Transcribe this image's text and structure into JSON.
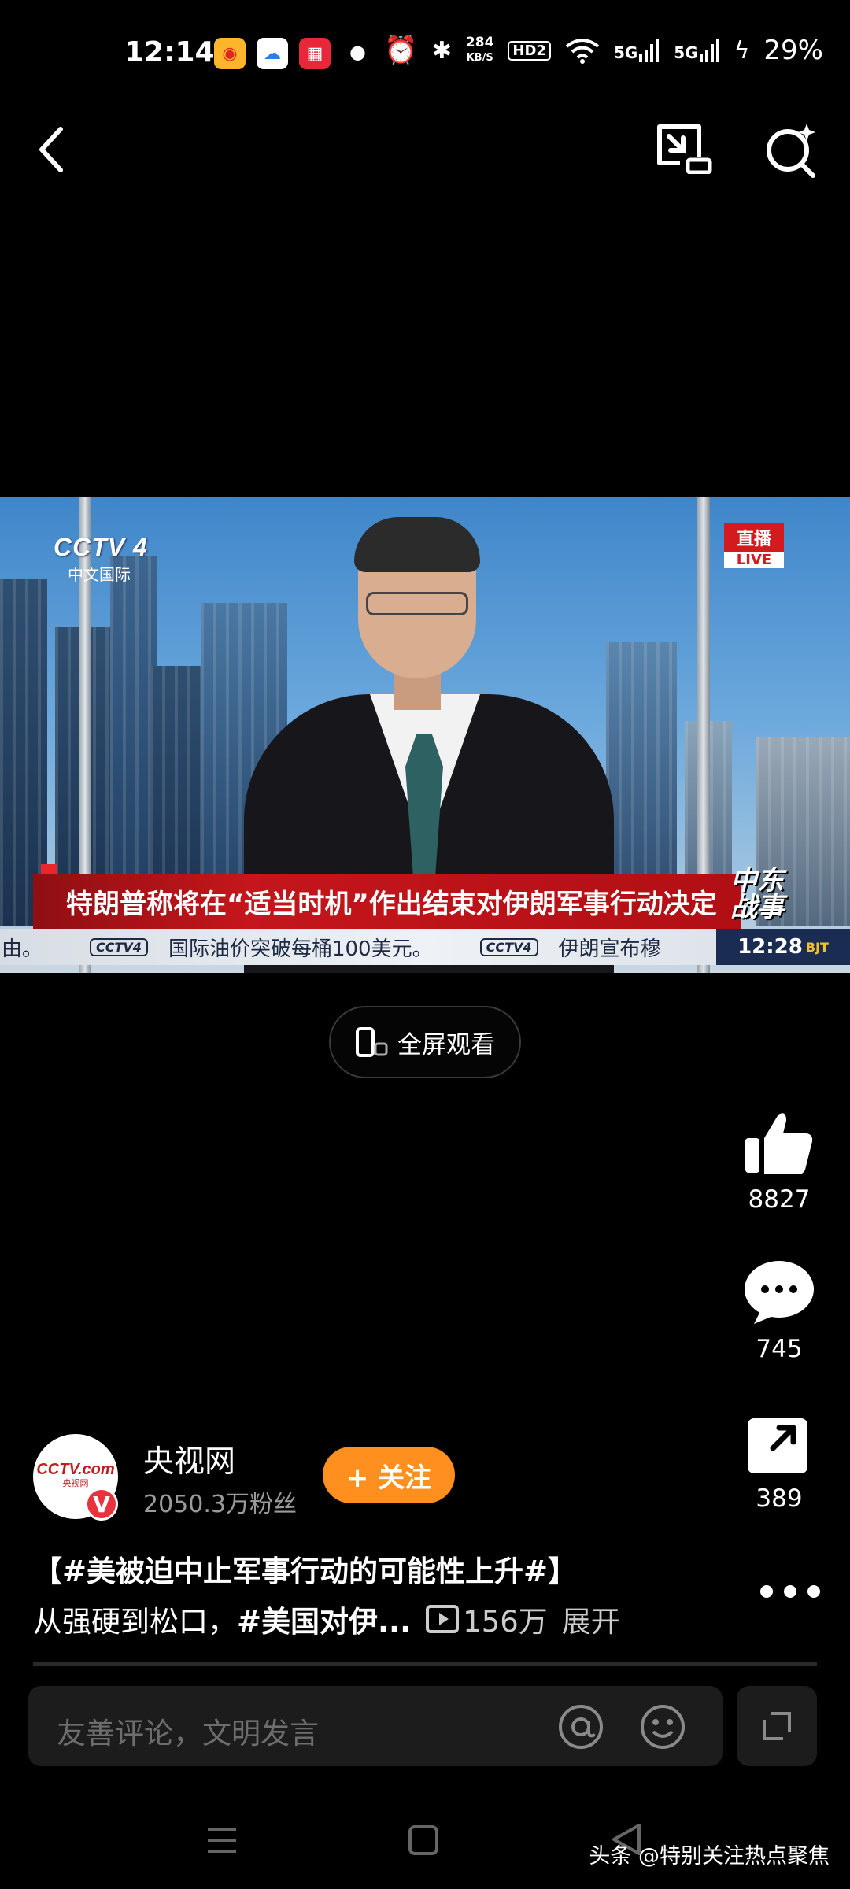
{
  "status_bar": {
    "time": "12:14",
    "apps": [
      "weibo",
      "cloud",
      "grid"
    ],
    "net_speed_value": "284",
    "net_speed_unit": "KB/S",
    "hd": "HD2",
    "sig1": "5G",
    "sig2": "5G",
    "battery": "29%"
  },
  "video": {
    "channel_logo": "CCTV 4",
    "channel_sub": "中文国际",
    "live_zh": "直播",
    "live_en": "LIVE",
    "headline": "特朗普称将在“适当时机”作出结束对伊朗军事行动决定",
    "ticker_1": "由。",
    "ticker_2": "国际油价突破每桶100美元。",
    "ticker_3": "伊朗宣布穆",
    "ticker_logo": "CCTV4",
    "clock": "12:28",
    "clock_zone": "BJT",
    "corner_tag_1": "中东",
    "corner_tag_2": "战事"
  },
  "fullscreen_label": "全屏观看",
  "actions": {
    "likes": "8827",
    "comments": "745",
    "shares": "389"
  },
  "author": {
    "name": "央视网",
    "fans": "2050.3万粉丝",
    "follow_label": "+ 关注",
    "avatar_text": "CCTV.com",
    "avatar_sub": "央视网",
    "badge": "V"
  },
  "caption": {
    "line1": "【#美被迫中止军事行动的可能性上升#】",
    "line2_plain": "从强硬到松口，",
    "line2_tag": "#美国对伊...",
    "views": "156万",
    "expand": "展开"
  },
  "comment_placeholder": "友善评论，文明发言",
  "watermark": "头条 @特别关注热点聚焦",
  "colors": {
    "follow": "#ff8f1f",
    "headline_red": "#c4161c"
  }
}
